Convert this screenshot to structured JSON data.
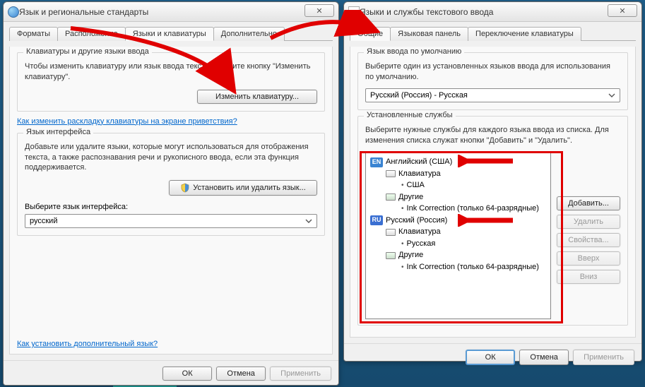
{
  "left": {
    "title": "Язык и региональные стандарты",
    "tabs": [
      "Форматы",
      "Расположение",
      "Языки и клавиатуры",
      "Дополнительно"
    ],
    "activeTab": 2,
    "group1": {
      "legend": "Клавиатуры и другие языки ввода",
      "desc": "Чтобы изменить клавиатуру или язык ввода текста, нажмите кнопку \"Изменить клавиатуру\".",
      "button": "Изменить клавиатуру..."
    },
    "link1": "Как изменить раскладку клавиатуры на экране приветствия?",
    "group2": {
      "legend": "Язык интерфейса",
      "desc": "Добавьте или удалите языки, которые могут использоваться для отображения текста, а также распознавания речи и рукописного ввода, если эта функция поддерживается.",
      "button": "Установить или удалить язык...",
      "selectLabel": "Выберите язык интерфейса:",
      "selected": "русский"
    },
    "link2": "Как установить дополнительный язык?",
    "buttons": {
      "ok": "ОК",
      "cancel": "Отмена",
      "apply": "Применить"
    }
  },
  "right": {
    "title": "Языки и службы текстового ввода",
    "tabs": [
      "Общие",
      "Языковая панель",
      "Переключение клавиатуры"
    ],
    "activeTab": 0,
    "group1": {
      "legend": "Язык ввода по умолчанию",
      "desc": "Выберите один из установленных языков ввода для использования по умолчанию.",
      "selected": "Русский (Россия) - Русская"
    },
    "group2": {
      "legend": "Установленные службы",
      "desc": "Выберите нужные службы для каждого языка ввода из списка. Для изменения списка служат кнопки \"Добавить\" и \"Удалить\".",
      "tree": {
        "en": {
          "badge": "EN",
          "lang": "Английский (США)",
          "kbdLabel": "Клавиатура",
          "kbdItem": "США",
          "otherLabel": "Другие",
          "otherItem": "Ink Correction (только 64-разрядные)"
        },
        "ru": {
          "badge": "RU",
          "lang": "Русский (Россия)",
          "kbdLabel": "Клавиатура",
          "kbdItem": "Русская",
          "otherLabel": "Другие",
          "otherItem": "Ink Correction (только 64-разрядные)"
        }
      },
      "sideButtons": {
        "add": "Добавить...",
        "remove": "Удалить",
        "props": "Свойства...",
        "up": "Вверх",
        "down": "Вниз"
      }
    },
    "buttons": {
      "ok": "ОК",
      "cancel": "Отмена",
      "apply": "Применить"
    }
  }
}
